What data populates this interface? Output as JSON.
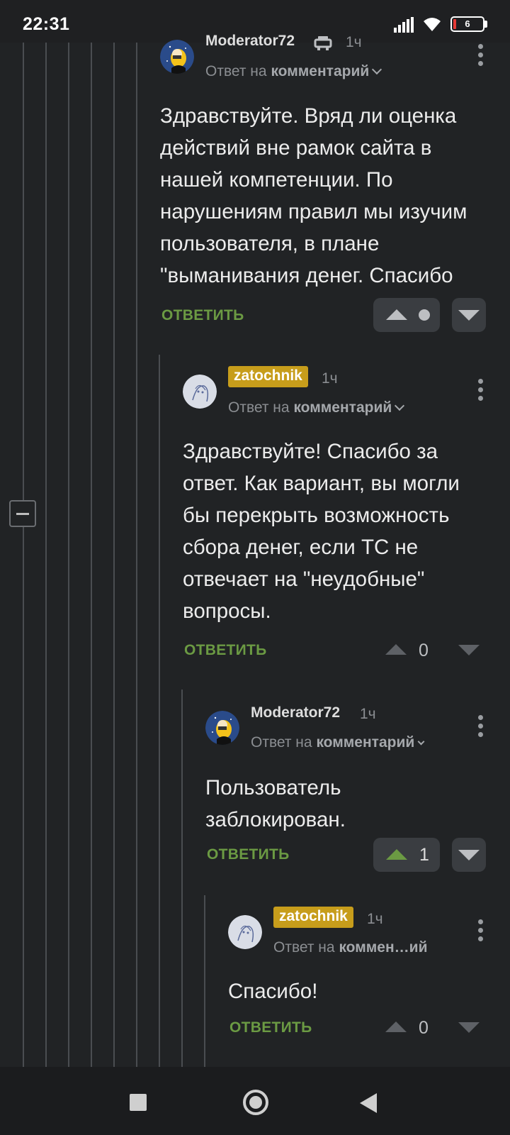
{
  "status_bar": {
    "time": "22:31",
    "battery": "6",
    "icons": [
      "signal-icon",
      "wifi-icon",
      "battery-icon"
    ]
  },
  "comments": [
    {
      "author": "Moderator72",
      "author_style": "plain",
      "has_moderator_icon": true,
      "time": "1ч",
      "reply_prefix": "Ответ на",
      "reply_target": "комментарий",
      "text": "Здравствуйте. Вряд ли оценка действий вне рамок сайта в нашей компетенции. По нарушениям правил мы изучим пользователя, в плане \"выманивания денег. Спасибо",
      "reply_label": "ОТВЕТИТЬ",
      "score": "",
      "score_display": "dot"
    },
    {
      "author": "zatochnik",
      "author_style": "badge",
      "time": "1ч",
      "reply_prefix": "Ответ на",
      "reply_target": "комментарий",
      "text": "Здравствуйте! Спасибо за ответ. Как вариант, вы могли бы перекрыть возможность сбора денег, если ТС не отвечает на \"неудобные\" вопросы.",
      "reply_label": "ОТВЕТИТЬ",
      "score": "0"
    },
    {
      "author": "Moderator72",
      "author_style": "plain",
      "time": "1ч",
      "reply_prefix": "Ответ на",
      "reply_target": "комментарий",
      "text": "Пользователь заблокирован.",
      "reply_label": "ОТВЕТИТЬ",
      "score": "1",
      "upvoted": true
    },
    {
      "author": "zatochnik",
      "author_style": "badge",
      "time": "1ч",
      "reply_prefix": "Ответ на",
      "reply_target": "коммен…ий",
      "text": "Спасибо!",
      "reply_label": "ОТВЕТИТЬ",
      "score": "0"
    }
  ],
  "colors": {
    "background": "#212325",
    "reply_green": "#6b9a43",
    "badge_gold": "#c79d1b",
    "thread_line": "#4a4d51"
  },
  "navigation_bar": {
    "icons": [
      "recents-icon",
      "home-icon",
      "back-icon"
    ]
  }
}
